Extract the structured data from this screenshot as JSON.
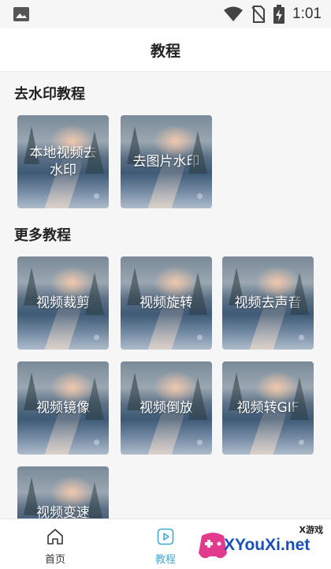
{
  "status_bar": {
    "time": "1:01"
  },
  "title": "教程",
  "sections": [
    {
      "title": "去水印教程",
      "items": [
        "本地视频去水印",
        "去图片水印"
      ]
    },
    {
      "title": "更多教程",
      "items": [
        "视频裁剪",
        "视频旋转",
        "视频去声音",
        "视频镜像",
        "视频倒放",
        "视频转GIF",
        "视频变速"
      ]
    }
  ],
  "bottom_nav": {
    "items": [
      {
        "label": "首页",
        "icon": "home-icon",
        "active": false
      },
      {
        "label": "教程",
        "icon": "play-icon",
        "active": true
      }
    ],
    "active_color": "#3fa9d8",
    "inactive_color": "#333333"
  },
  "watermark": {
    "top": "X游戏",
    "main": "XYouXi.net"
  }
}
